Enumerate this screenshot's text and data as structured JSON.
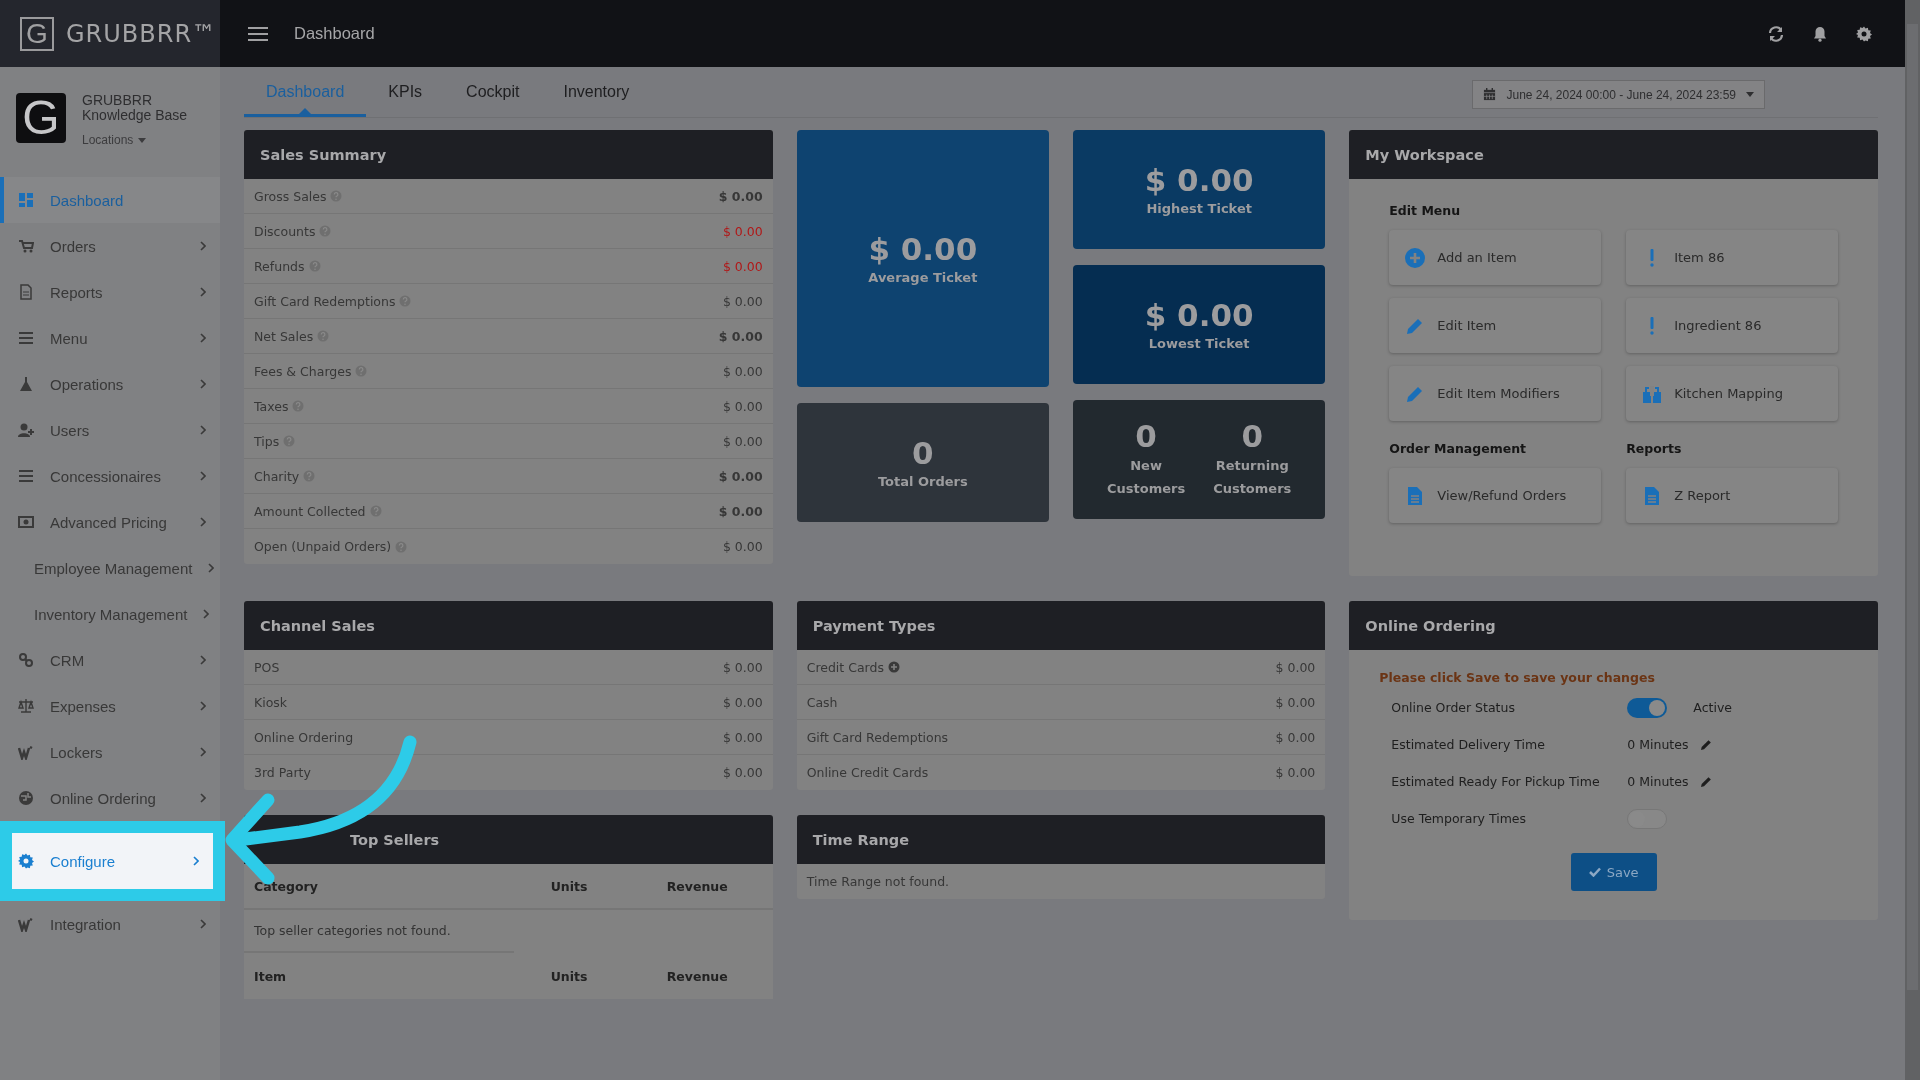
{
  "brand": {
    "name": "GRUBBRR™",
    "logo_letter": "G"
  },
  "top_bar": {
    "title": "Dashboard"
  },
  "account": {
    "logo_letter": "G",
    "name": "GRUBBRR Knowledge Base",
    "locations": "Locations"
  },
  "sidebar": {
    "items": [
      {
        "label": "Dashboard",
        "selected": true,
        "highlighted": false,
        "has_children": false
      },
      {
        "label": "Orders",
        "selected": false,
        "highlighted": false,
        "has_children": true
      },
      {
        "label": "Reports",
        "selected": false,
        "highlighted": false,
        "has_children": true
      },
      {
        "label": "Menu",
        "selected": false,
        "highlighted": false,
        "has_children": true
      },
      {
        "label": "Operations",
        "selected": false,
        "highlighted": false,
        "has_children": true
      },
      {
        "label": "Users",
        "selected": false,
        "highlighted": false,
        "has_children": true
      },
      {
        "label": "Concessionaires",
        "selected": false,
        "highlighted": false,
        "has_children": true
      },
      {
        "label": "Advanced Pricing",
        "selected": false,
        "highlighted": false,
        "has_children": true
      },
      {
        "label": "Employee Management",
        "selected": false,
        "highlighted": false,
        "has_children": true
      },
      {
        "label": "Inventory Management",
        "selected": false,
        "highlighted": false,
        "has_children": true
      },
      {
        "label": "CRM",
        "selected": false,
        "highlighted": false,
        "has_children": true
      },
      {
        "label": "Expenses",
        "selected": false,
        "highlighted": false,
        "has_children": true
      },
      {
        "label": "Lockers",
        "selected": false,
        "highlighted": false,
        "has_children": true
      },
      {
        "label": "Online Ordering",
        "selected": false,
        "highlighted": false,
        "has_children": true
      },
      {
        "label": "Configure",
        "selected": false,
        "highlighted": true,
        "has_children": true
      },
      {
        "label": "Integration",
        "selected": false,
        "highlighted": false,
        "has_children": true
      }
    ]
  },
  "tabs": [
    {
      "label": "Dashboard",
      "selected": true
    },
    {
      "label": "KPIs",
      "selected": false
    },
    {
      "label": "Cockpit",
      "selected": false
    },
    {
      "label": "Inventory",
      "selected": false
    }
  ],
  "date_range": {
    "value": "June 24, 2024 00:00 - June 24, 2024 23:59"
  },
  "sales_summary": {
    "title": "Sales Summary",
    "rows": [
      {
        "label": "Gross Sales",
        "value": "$ 0.00",
        "negative": false,
        "bold": true
      },
      {
        "label": "Discounts",
        "value": "$ 0.00",
        "negative": true,
        "bold": false
      },
      {
        "label": "Refunds",
        "value": "$ 0.00",
        "negative": true,
        "bold": false
      },
      {
        "label": "Gift Card Redemptions",
        "value": "$ 0.00",
        "negative": false,
        "bold": false
      },
      {
        "label": "Net Sales",
        "value": "$ 0.00",
        "negative": false,
        "bold": true
      },
      {
        "label": "Fees & Charges",
        "value": "$ 0.00",
        "negative": false,
        "bold": false
      },
      {
        "label": "Taxes",
        "value": "$ 0.00",
        "negative": false,
        "bold": false
      },
      {
        "label": "Tips",
        "value": "$ 0.00",
        "negative": false,
        "bold": false
      },
      {
        "label": "Charity",
        "value": "$ 0.00",
        "negative": false,
        "bold": true
      },
      {
        "label": "Amount Collected",
        "value": "$ 0.00",
        "negative": false,
        "bold": true
      },
      {
        "label": "Open (Unpaid Orders)",
        "value": "$ 0.00",
        "negative": false,
        "bold": false
      }
    ]
  },
  "tiles": [
    {
      "value": "$ 0.00",
      "label": "Average Ticket",
      "color": "#0e4370"
    },
    {
      "value": "$ 0.00",
      "label": "Highest Ticket",
      "color": "#0a3a63"
    },
    {
      "value": "$ 0.00",
      "label": "Lowest Ticket",
      "color": "#052d51"
    },
    {
      "value": "0",
      "label": "Total Orders",
      "color": "#2e343b"
    }
  ],
  "customers_tile": {
    "color": "#22292f",
    "parts": [
      {
        "value": "0",
        "label": "New Customers"
      },
      {
        "value": "0",
        "label": "Returning Customers"
      }
    ]
  },
  "workspace": {
    "title": "My Workspace",
    "sections": [
      {
        "title": "Edit Menu",
        "buttons": [
          "Add an Item",
          "Item 86",
          "Edit Item",
          "Ingredient 86",
          "Edit Item Modifiers",
          "Kitchen Mapping"
        ]
      },
      {
        "title": "Order Management",
        "buttons": [
          "View/Refund Orders"
        ]
      },
      {
        "title": "Reports",
        "buttons": [
          "Z Report"
        ]
      }
    ]
  },
  "channel_sales": {
    "title": "Channel Sales",
    "rows": [
      {
        "label": "POS",
        "value": "$ 0.00"
      },
      {
        "label": "Kiosk",
        "value": "$ 0.00"
      },
      {
        "label": "Online Ordering",
        "value": "$ 0.00"
      },
      {
        "label": "3rd Party",
        "value": "$ 0.00"
      }
    ]
  },
  "payment_types": {
    "title": "Payment Types",
    "rows": [
      {
        "label": "Credit Cards",
        "value": "$ 0.00",
        "expandable": true
      },
      {
        "label": "Cash",
        "value": "$ 0.00",
        "expandable": false
      },
      {
        "label": "Gift Card Redemptions",
        "value": "$ 0.00",
        "expandable": false
      },
      {
        "label": "Online Credit Cards",
        "value": "$ 0.00",
        "expandable": false
      }
    ]
  },
  "online_ordering": {
    "title": "Online Ordering",
    "note": "Please click Save to save your changes",
    "settings": [
      {
        "kind": "toggle",
        "label": "Online Order Status",
        "on": true,
        "status": "Active"
      },
      {
        "kind": "editable",
        "label": "Estimated Delivery Time",
        "value": "0 Minutes"
      },
      {
        "kind": "editable",
        "label": "Estimated Ready For Pickup Time",
        "value": "0 Minutes"
      },
      {
        "kind": "toggle",
        "label": "Use Temporary Times",
        "on": false
      }
    ],
    "save_button": "Save"
  },
  "top_sellers": {
    "title": "Top Sellers",
    "category_columns": [
      "Category",
      "Units",
      "Revenue"
    ],
    "category_empty": "Top seller categories not found.",
    "item_columns": [
      "Item",
      "Units",
      "Revenue"
    ]
  },
  "time_range": {
    "title": "Time Range",
    "empty": "Time Range not found."
  }
}
